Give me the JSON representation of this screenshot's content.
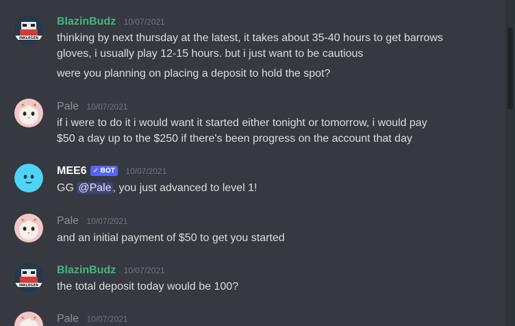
{
  "messages": [
    {
      "author": "BlazinBudz",
      "author_color": "#43b581",
      "timestamp": "10/07/2021",
      "lines": [
        "thinking by next thursday at the latest, it takes about 35-40 hours to get barrows",
        "gloves, i usually play 12-15 hours. but i just want to be cautious",
        "were you planning on placing a deposit to hold the spot?"
      ]
    },
    {
      "author": "Pale",
      "author_color": "#8e9297",
      "timestamp": "10/07/2021",
      "lines": [
        "if i were to do it i would want it started either tonight or tomorrow, i would pay",
        "$50 a day up to the $250 if there's been progress on the account that day"
      ]
    },
    {
      "author": "MEE6",
      "author_color": "#ffffff",
      "bot_tag": "BOT",
      "bot_check": "✓",
      "timestamp": "10/07/2021",
      "line_pre": "GG ",
      "mention": "@Pale",
      "line_post": ", you just advanced to level 1!"
    },
    {
      "author": "Pale",
      "author_color": "#8e9297",
      "timestamp": "10/07/2021",
      "lines": [
        "and an initial payment of $50 to get you started"
      ]
    },
    {
      "author": "BlazinBudz",
      "author_color": "#43b581",
      "timestamp": "10/07/2021",
      "lines": [
        "the total deposit today would be 100?"
      ]
    },
    {
      "author": "Pale",
      "author_color": "#8e9297",
      "timestamp": "10/07/2021",
      "lines": []
    }
  ],
  "avatar_text": {
    "blazin": "INKLEGEN"
  },
  "icons": {
    "blazin_avatar": "blazinbudz-avatar",
    "pale_avatar": "cat-avatar",
    "mee6_avatar": "mee6-bot-avatar"
  }
}
